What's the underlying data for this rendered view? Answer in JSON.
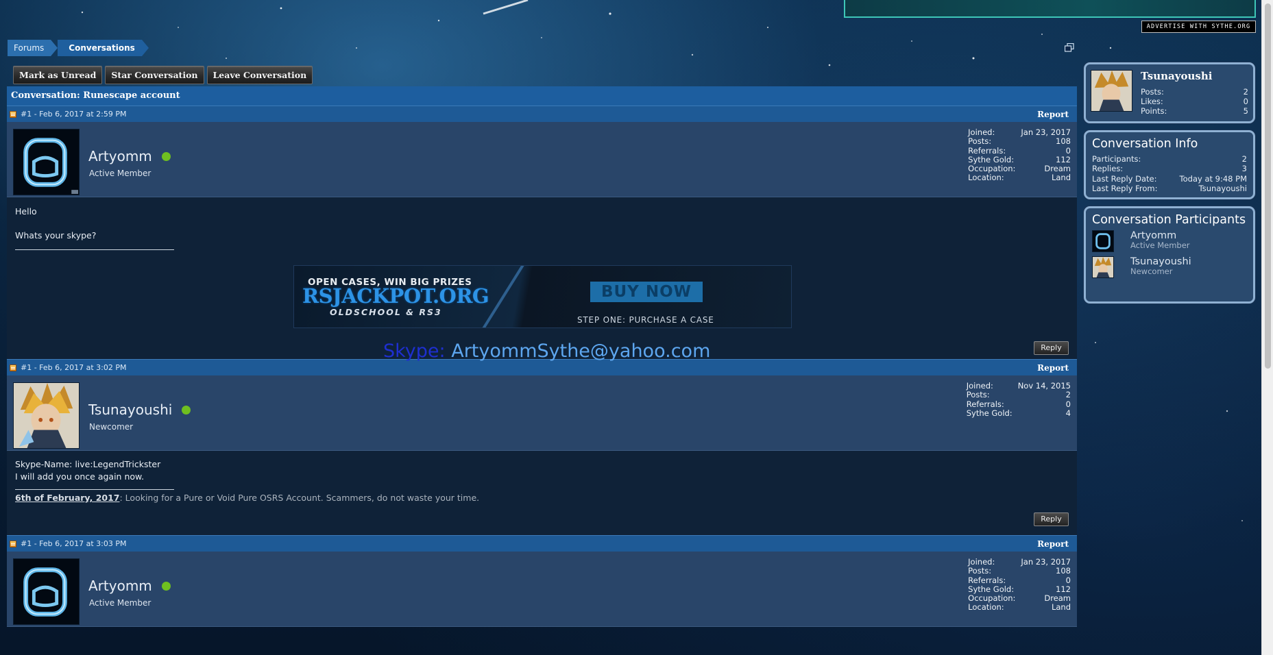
{
  "ad": {
    "advertise_label": "ADVERTISE WITH SYTHE.ORG"
  },
  "breadcrumb": {
    "items": [
      "Forums",
      "Conversations"
    ]
  },
  "actions": {
    "mark_unread": "Mark as Unread",
    "star": "Star Conversation",
    "leave": "Leave Conversation"
  },
  "conversation": {
    "title": "Conversation: Runescape account"
  },
  "posts": [
    {
      "meta": "#1 - Feb 6, 2017 at 2:59 PM",
      "report": "Report",
      "username": "Artyomm",
      "usertitle": "Active Member",
      "stats": [
        {
          "label": "Joined:",
          "value": "Jan 23, 2017"
        },
        {
          "label": "Posts:",
          "value": "108"
        },
        {
          "label": "Referrals:",
          "value": "0"
        },
        {
          "label": "Sythe Gold:",
          "value": "112"
        },
        {
          "label": "Occupation:",
          "value": "Dream"
        },
        {
          "label": "Location:",
          "value": "Land"
        }
      ],
      "message_lines": [
        "Hello",
        "",
        "Whats your skype?"
      ],
      "banner": {
        "line1": "OPEN CASES, WIN BIG PRIZES",
        "line2": "RSJACKPOT.ORG",
        "line3": "OLDSCHOOL & RS3",
        "buy": "BUY NOW",
        "step": "STEP ONE: PURCHASE A CASE"
      },
      "skype_label": "Skype:",
      "skype_value": "ArtyommSythe@yahoo.com",
      "reply": "Reply"
    },
    {
      "meta": "#1 - Feb 6, 2017 at 3:02 PM",
      "report": "Report",
      "username": "Tsunayoushi",
      "usertitle": "Newcomer",
      "stats": [
        {
          "label": "Joined:",
          "value": "Nov 14, 2015"
        },
        {
          "label": "Posts:",
          "value": "2"
        },
        {
          "label": "Referrals:",
          "value": "0"
        },
        {
          "label": "Sythe Gold:",
          "value": "4"
        }
      ],
      "message_lines": [
        "Skype-Name: live:LegendTrickster",
        "I will add you once again now."
      ],
      "signature_date": "6th of February, 2017",
      "signature_text": ": Looking for a Pure or Void Pure OSRS Account. Scammers, do not waste your time.",
      "reply": "Reply"
    },
    {
      "meta": "#1 - Feb 6, 2017 at 3:03 PM",
      "report": "Report",
      "username": "Artyomm",
      "usertitle": "Active Member",
      "stats": [
        {
          "label": "Joined:",
          "value": "Jan 23, 2017"
        },
        {
          "label": "Posts:",
          "value": "108"
        },
        {
          "label": "Referrals:",
          "value": "0"
        },
        {
          "label": "Sythe Gold:",
          "value": "112"
        },
        {
          "label": "Occupation:",
          "value": "Dream"
        },
        {
          "label": "Location:",
          "value": "Land"
        }
      ]
    }
  ],
  "sidebar": {
    "visitor": {
      "name": "Tsunayoushi",
      "stats": [
        {
          "label": "Posts:",
          "value": "2"
        },
        {
          "label": "Likes:",
          "value": "0"
        },
        {
          "label": "Points:",
          "value": "5"
        }
      ]
    },
    "info": {
      "title": "Conversation Info",
      "rows": [
        {
          "label": "Participants:",
          "value": "2"
        },
        {
          "label": "Replies:",
          "value": "3"
        },
        {
          "label": "Last Reply Date:",
          "value": "Today at 9:48 PM"
        },
        {
          "label": "Last Reply From:",
          "value": "Tsunayoushi"
        }
      ]
    },
    "participants": {
      "title": "Conversation Participants",
      "list": [
        {
          "name": "Artyomm",
          "title": "Active Member"
        },
        {
          "name": "Tsunayoushi",
          "title": "Newcomer"
        }
      ]
    }
  },
  "colors": {
    "header_blue": "#1e5a96",
    "panel": "#294569",
    "body": "#0f2238",
    "online": "#6fbf20",
    "skype_label": "#1e2fd0",
    "skype_value": "#5da6ef"
  }
}
